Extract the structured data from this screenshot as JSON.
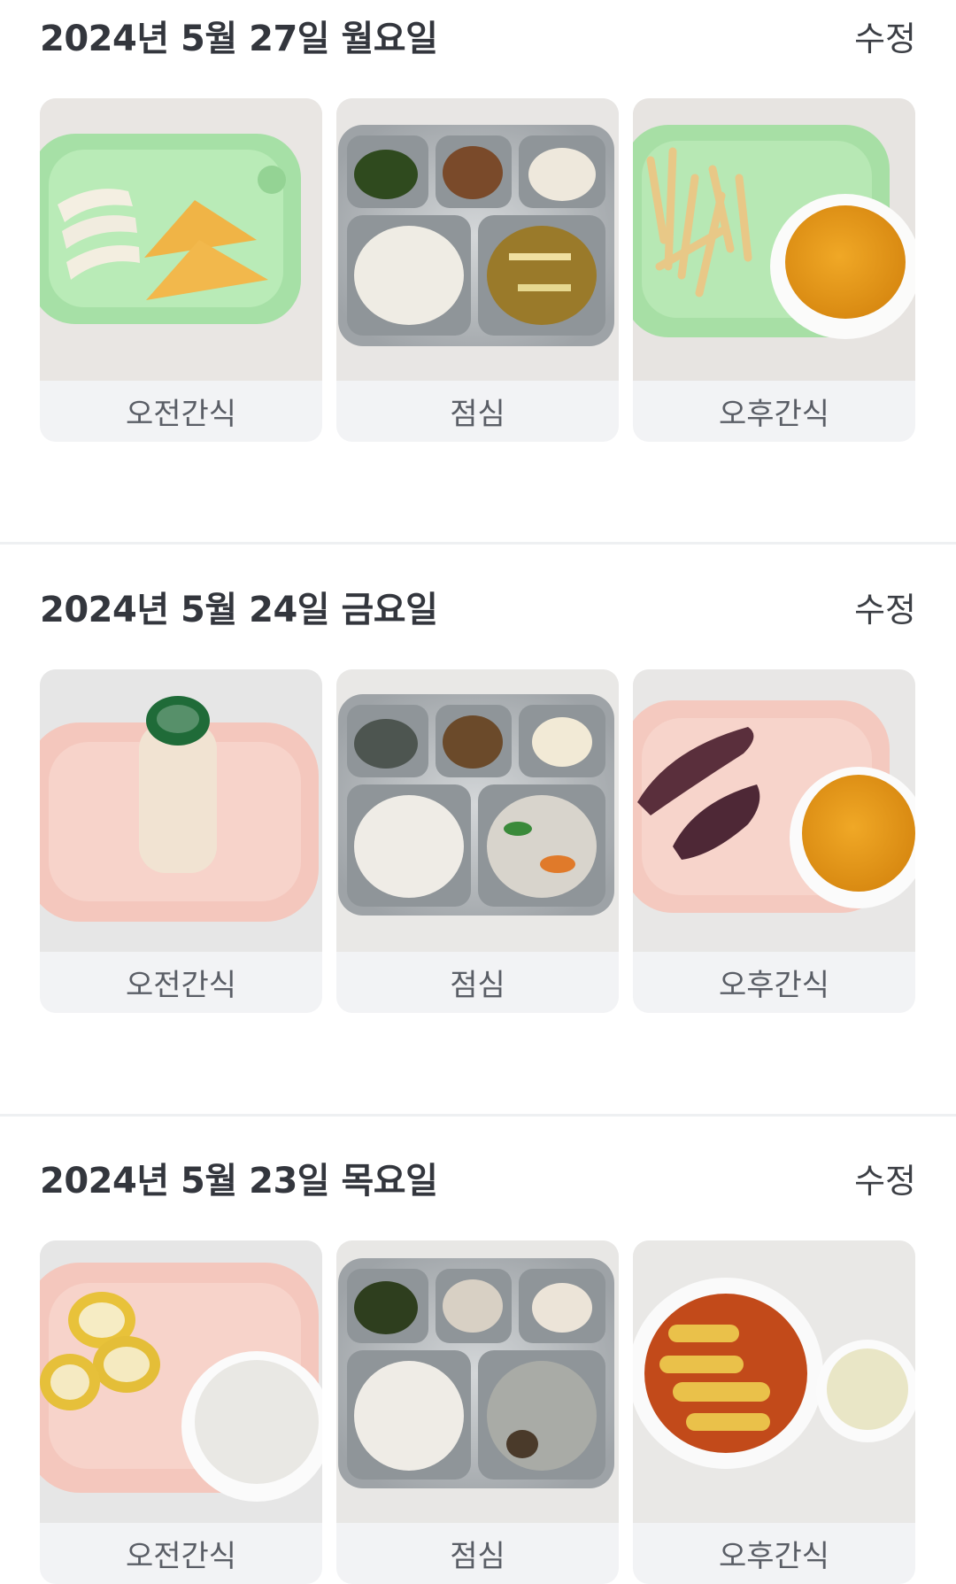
{
  "days": [
    {
      "title": "2024년 5월 27일 월요일",
      "edit_label": "수정",
      "meals": [
        {
          "label": "오전간식",
          "photo": "green-plate-pear-pancake"
        },
        {
          "label": "점심",
          "photo": "steel-tray-rice-soup"
        },
        {
          "label": "오후간식",
          "photo": "green-plate-fries-juice"
        }
      ]
    },
    {
      "title": "2024년 5월 24일 금요일",
      "edit_label": "수정",
      "meals": [
        {
          "label": "오전간식",
          "photo": "pink-plate-yogurt-drink"
        },
        {
          "label": "점심",
          "photo": "steel-tray-rice-stew"
        },
        {
          "label": "오후간식",
          "photo": "pink-plate-sweet-potato-juice"
        }
      ]
    },
    {
      "title": "2024년 5월 23일 목요일",
      "edit_label": "수정",
      "meals": [
        {
          "label": "오전간식",
          "photo": "pink-plate-banana-milk"
        },
        {
          "label": "점심",
          "photo": "steel-tray-rice-noodle-soup"
        },
        {
          "label": "오후간식",
          "photo": "bowl-tteokbokki-juice"
        }
      ]
    }
  ],
  "colors": {
    "plate_green": "#a8e3a6",
    "plate_pink": "#f6cdc3",
    "tray_steel": "#b8bcbf",
    "label_bg": "#f2f3f5",
    "juice": "#e09a1c"
  }
}
